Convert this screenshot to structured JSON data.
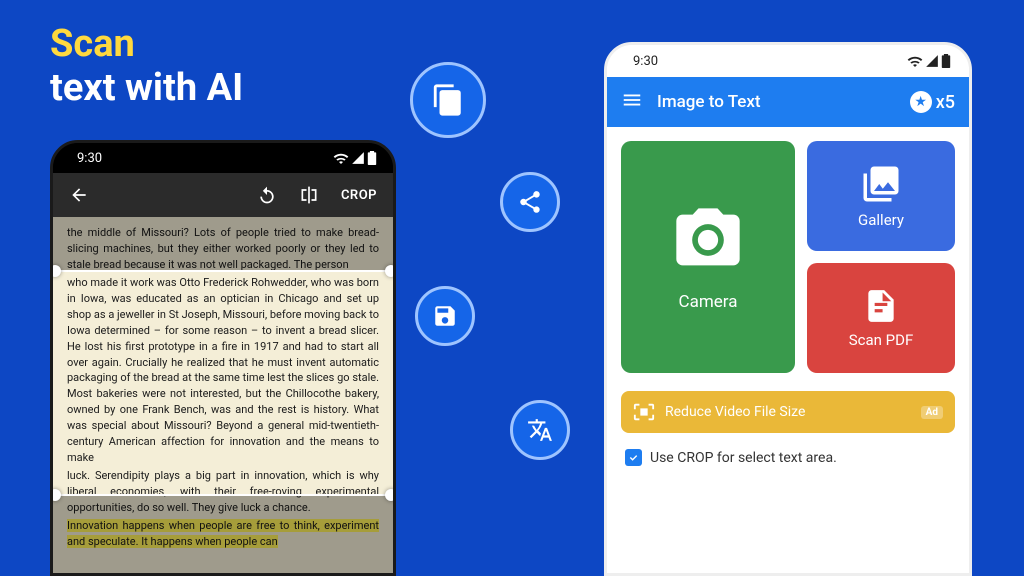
{
  "hero": {
    "line1": "Scan",
    "line2": "text with AI"
  },
  "fab": {
    "copy": "copy",
    "share": "share",
    "save": "save",
    "translate": "translate"
  },
  "scanner": {
    "time": "9:30",
    "crop_label": "CROP",
    "book_text_top": "the middle of Missouri? Lots of people tried to make bread-slicing machines, but they either worked poorly or they led to stale bread because it was not well packaged. The person",
    "book_text_mid": "who made it work was Otto Frederick Rohwedder, who was born in Iowa, was educated as an optician in Chicago and set up shop as a jeweller in St Joseph, Missouri, before moving back to Iowa determined – for some reason – to invent a bread slicer. He lost his first prototype in a fire in 1917 and had to start all over again. Crucially he realized that he must invent automatic packaging of the bread at the same time lest the slices go stale. Most bakeries were not interested, but the Chillocothe bakery, owned by one Frank Bench, was and the rest is history. What was special about Missouri? Beyond a general mid-twentieth-century American affection for innovation and the means to make",
    "book_text_bottom1": "luck. Serendipity plays a big part in innovation, which is why liberal economies, with their free-roving experimental opportunities, do so well. They give luck a chance.",
    "book_text_bottom2_pre": "    ",
    "book_text_bottom2_hl": "Innovation happens when people are free to think, experiment and speculate. It happens when people can"
  },
  "app": {
    "time": "9:30",
    "title": "Image to Text",
    "credits": "x5",
    "camera": "Camera",
    "gallery": "Gallery",
    "scan_pdf": "Scan PDF",
    "promo": "Reduce Video File Size",
    "ad": "Ad",
    "checkbox_label": "Use CROP for select text area."
  }
}
